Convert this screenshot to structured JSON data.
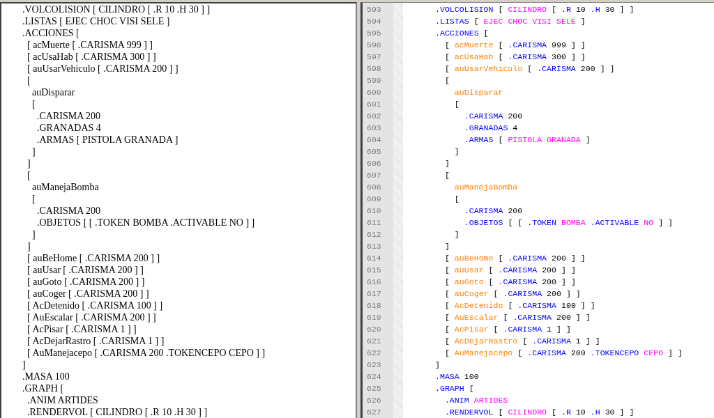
{
  "text_pane": {
    "lines": [
      ".VOLCOLISION [ CILINDRO [ .R 10 .H 30 ] ]",
      ".LISTAS [ EJEC CHOC VISI SELE ]",
      ".ACCIONES [",
      "  [ acMuerte [ .CARISMA 999 ] ]",
      "  [ acUsaHab [ .CARISMA 300 ] ]",
      "  [ auUsarVehiculo [ .CARISMA 200 ] ]",
      "  [",
      "    auDisparar",
      "    [",
      "      .CARISMA 200",
      "      .GRANADAS 4",
      "      .ARMAS [ PISTOLA GRANADA ]",
      "    ]",
      "  ]",
      "  [",
      "    auManejaBomba",
      "    [",
      "      .CARISMA 200",
      "      .OBJETOS [ [ .TOKEN BOMBA .ACTIVABLE NO ] ]",
      "    ]",
      "  ]",
      "  [ auBeHome [ .CARISMA 200 ] ]",
      "  [ auUsar [ .CARISMA 200 ] ]",
      "  [ auGoto [ .CARISMA 200 ] ]",
      "  [ auCoger [ .CARISMA 200 ] ]",
      "  [ AcDetenido [ .CARISMA 100 ] ]",
      "  [ AuEscalar [ .CARISMA 200 ] ]",
      "  [ AcPisar [ .CARISMA 1 ] ]",
      "  [ AcDejarRastro [ .CARISMA 1 ] ]",
      "  [ AuManejacepo [ .CARISMA 200 .TOKENCEPO CEPO ] ]",
      "]",
      ".MASA 100",
      ".GRAPH [",
      "  .ANIM ARTIDES",
      "  .RENDERVOL [ CILINDRO [ .R 10 .H 30 ] ]"
    ]
  },
  "editor_pane": {
    "lines": [
      {
        "number": "593",
        "tokens": [
          {
            "kind": "keyword",
            "text": ".VOLCOLISION"
          },
          {
            "kind": "plain",
            "text": "["
          },
          {
            "kind": "value",
            "text": "CILINDRO"
          },
          {
            "kind": "plain",
            "text": "["
          },
          {
            "kind": "keyword",
            "text": ".R"
          },
          {
            "kind": "plain",
            "text": "10"
          },
          {
            "kind": "keyword",
            "text": ".H"
          },
          {
            "kind": "plain",
            "text": "30 ] ]"
          }
        ]
      },
      {
        "number": "594",
        "tokens": [
          {
            "kind": "keyword",
            "text": ".LISTAS"
          },
          {
            "kind": "plain",
            "text": "["
          },
          {
            "kind": "value",
            "text": "EJEC CHOC VISI SELE"
          },
          {
            "kind": "plain",
            "text": "]"
          }
        ]
      },
      {
        "number": "595",
        "tokens": [
          {
            "kind": "keyword",
            "text": ".ACCIONES"
          },
          {
            "kind": "plain",
            "text": "["
          }
        ]
      },
      {
        "number": "596",
        "tokens": [
          {
            "kind": "plain",
            "text": "  ["
          },
          {
            "kind": "name",
            "text": "acMuerte"
          },
          {
            "kind": "plain",
            "text": "["
          },
          {
            "kind": "keyword",
            "text": ".CARISMA"
          },
          {
            "kind": "plain",
            "text": "999 ] ]"
          }
        ]
      },
      {
        "number": "597",
        "tokens": [
          {
            "kind": "plain",
            "text": "  ["
          },
          {
            "kind": "name",
            "text": "acUsaHab"
          },
          {
            "kind": "plain",
            "text": "["
          },
          {
            "kind": "keyword",
            "text": ".CARISMA"
          },
          {
            "kind": "plain",
            "text": "300 ] ]"
          }
        ]
      },
      {
        "number": "598",
        "tokens": [
          {
            "kind": "plain",
            "text": "  ["
          },
          {
            "kind": "name",
            "text": "auUsarVehiculo"
          },
          {
            "kind": "plain",
            "text": "["
          },
          {
            "kind": "keyword",
            "text": ".CARISMA"
          },
          {
            "kind": "plain",
            "text": "200 ] ]"
          }
        ]
      },
      {
        "number": "599",
        "tokens": [
          {
            "kind": "plain",
            "text": "  ["
          }
        ]
      },
      {
        "number": "600",
        "tokens": [
          {
            "kind": "name",
            "text": "    auDisparar"
          }
        ]
      },
      {
        "number": "601",
        "tokens": [
          {
            "kind": "plain",
            "text": "    ["
          }
        ]
      },
      {
        "number": "602",
        "tokens": [
          {
            "kind": "keyword",
            "text": "      .CARISMA"
          },
          {
            "kind": "plain",
            "text": "200"
          }
        ]
      },
      {
        "number": "603",
        "tokens": [
          {
            "kind": "keyword",
            "text": "      .GRANADAS"
          },
          {
            "kind": "plain",
            "text": "4"
          }
        ]
      },
      {
        "number": "604",
        "tokens": [
          {
            "kind": "keyword",
            "text": "      .ARMAS"
          },
          {
            "kind": "plain",
            "text": "["
          },
          {
            "kind": "value",
            "text": "PISTOLA GRANADA"
          },
          {
            "kind": "plain",
            "text": "]"
          }
        ]
      },
      {
        "number": "605",
        "tokens": [
          {
            "kind": "plain",
            "text": "    ]"
          }
        ]
      },
      {
        "number": "606",
        "tokens": [
          {
            "kind": "plain",
            "text": "  ]"
          }
        ]
      },
      {
        "number": "607",
        "tokens": [
          {
            "kind": "plain",
            "text": "  ["
          }
        ]
      },
      {
        "number": "608",
        "tokens": [
          {
            "kind": "name",
            "text": "    auManejaBomba"
          }
        ]
      },
      {
        "number": "609",
        "tokens": [
          {
            "kind": "plain",
            "text": "    ["
          }
        ]
      },
      {
        "number": "610",
        "tokens": [
          {
            "kind": "keyword",
            "text": "      .CARISMA"
          },
          {
            "kind": "plain",
            "text": "200"
          }
        ]
      },
      {
        "number": "611",
        "tokens": [
          {
            "kind": "keyword",
            "text": "      .OBJETOS"
          },
          {
            "kind": "plain",
            "text": "[ ["
          },
          {
            "kind": "keyword",
            "text": ".TOKEN"
          },
          {
            "kind": "value",
            "text": "BOMBA"
          },
          {
            "kind": "keyword",
            "text": ".ACTIVABLE"
          },
          {
            "kind": "value",
            "text": "NO"
          },
          {
            "kind": "plain",
            "text": "] ]"
          }
        ]
      },
      {
        "number": "612",
        "tokens": [
          {
            "kind": "plain",
            "text": "    ]"
          }
        ]
      },
      {
        "number": "613",
        "tokens": [
          {
            "kind": "plain",
            "text": "  ]"
          }
        ]
      },
      {
        "number": "614",
        "tokens": [
          {
            "kind": "plain",
            "text": "  ["
          },
          {
            "kind": "name",
            "text": "auBeHome"
          },
          {
            "kind": "plain",
            "text": "["
          },
          {
            "kind": "keyword",
            "text": ".CARISMA"
          },
          {
            "kind": "plain",
            "text": "200 ] ]"
          }
        ]
      },
      {
        "number": "615",
        "tokens": [
          {
            "kind": "plain",
            "text": "  ["
          },
          {
            "kind": "name",
            "text": "auUsar"
          },
          {
            "kind": "plain",
            "text": "["
          },
          {
            "kind": "keyword",
            "text": ".CARISMA"
          },
          {
            "kind": "plain",
            "text": "200 ] ]"
          }
        ]
      },
      {
        "number": "616",
        "tokens": [
          {
            "kind": "plain",
            "text": "  ["
          },
          {
            "kind": "name",
            "text": "auGoto"
          },
          {
            "kind": "plain",
            "text": "["
          },
          {
            "kind": "keyword",
            "text": ".CARISMA"
          },
          {
            "kind": "plain",
            "text": "200 ] ]"
          }
        ]
      },
      {
        "number": "617",
        "tokens": [
          {
            "kind": "plain",
            "text": "  ["
          },
          {
            "kind": "name",
            "text": "auCoger"
          },
          {
            "kind": "plain",
            "text": "["
          },
          {
            "kind": "keyword",
            "text": ".CARISMA"
          },
          {
            "kind": "plain",
            "text": "200 ] ]"
          }
        ]
      },
      {
        "number": "618",
        "tokens": [
          {
            "kind": "plain",
            "text": "  ["
          },
          {
            "kind": "name",
            "text": "AcDetenido"
          },
          {
            "kind": "plain",
            "text": "["
          },
          {
            "kind": "keyword",
            "text": ".CARISMA"
          },
          {
            "kind": "plain",
            "text": "100 ] ]"
          }
        ]
      },
      {
        "number": "619",
        "tokens": [
          {
            "kind": "plain",
            "text": "  ["
          },
          {
            "kind": "name",
            "text": "AuEscalar"
          },
          {
            "kind": "plain",
            "text": "["
          },
          {
            "kind": "keyword",
            "text": ".CARISMA"
          },
          {
            "kind": "plain",
            "text": "200 ] ]"
          }
        ]
      },
      {
        "number": "620",
        "tokens": [
          {
            "kind": "plain",
            "text": "  ["
          },
          {
            "kind": "name",
            "text": "AcPisar"
          },
          {
            "kind": "plain",
            "text": "["
          },
          {
            "kind": "keyword",
            "text": ".CARISMA"
          },
          {
            "kind": "plain",
            "text": "1 ] ]"
          }
        ]
      },
      {
        "number": "621",
        "tokens": [
          {
            "kind": "plain",
            "text": "  ["
          },
          {
            "kind": "name",
            "text": "AcDejarRastro"
          },
          {
            "kind": "plain",
            "text": "["
          },
          {
            "kind": "keyword",
            "text": ".CARISMA"
          },
          {
            "kind": "plain",
            "text": "1 ] ]"
          }
        ]
      },
      {
        "number": "622",
        "tokens": [
          {
            "kind": "plain",
            "text": "  ["
          },
          {
            "kind": "name",
            "text": "AuManejacepo"
          },
          {
            "kind": "plain",
            "text": "["
          },
          {
            "kind": "keyword",
            "text": ".CARISMA"
          },
          {
            "kind": "plain",
            "text": "200"
          },
          {
            "kind": "keyword",
            "text": ".TOKENCEPO"
          },
          {
            "kind": "value",
            "text": "CEPO"
          },
          {
            "kind": "plain",
            "text": "] ]"
          }
        ]
      },
      {
        "number": "623",
        "tokens": [
          {
            "kind": "plain",
            "text": "]"
          }
        ]
      },
      {
        "number": "624",
        "tokens": [
          {
            "kind": "keyword",
            "text": ".MASA"
          },
          {
            "kind": "plain",
            "text": "100"
          }
        ]
      },
      {
        "number": "625",
        "tokens": [
          {
            "kind": "keyword",
            "text": ".GRAPH"
          },
          {
            "kind": "plain",
            "text": "["
          }
        ]
      },
      {
        "number": "626",
        "tokens": [
          {
            "kind": "keyword",
            "text": "  .ANIM"
          },
          {
            "kind": "value",
            "text": "ARTIDES"
          }
        ]
      },
      {
        "number": "627",
        "tokens": [
          {
            "kind": "keyword",
            "text": "  .RENDERVOL"
          },
          {
            "kind": "plain",
            "text": "["
          },
          {
            "kind": "value",
            "text": "CILINDRO"
          },
          {
            "kind": "plain",
            "text": "["
          },
          {
            "kind": "keyword",
            "text": ".R"
          },
          {
            "kind": "plain",
            "text": "10"
          },
          {
            "kind": "keyword",
            "text": ".H"
          },
          {
            "kind": "plain",
            "text": "30 ] ]"
          }
        ]
      }
    ]
  }
}
